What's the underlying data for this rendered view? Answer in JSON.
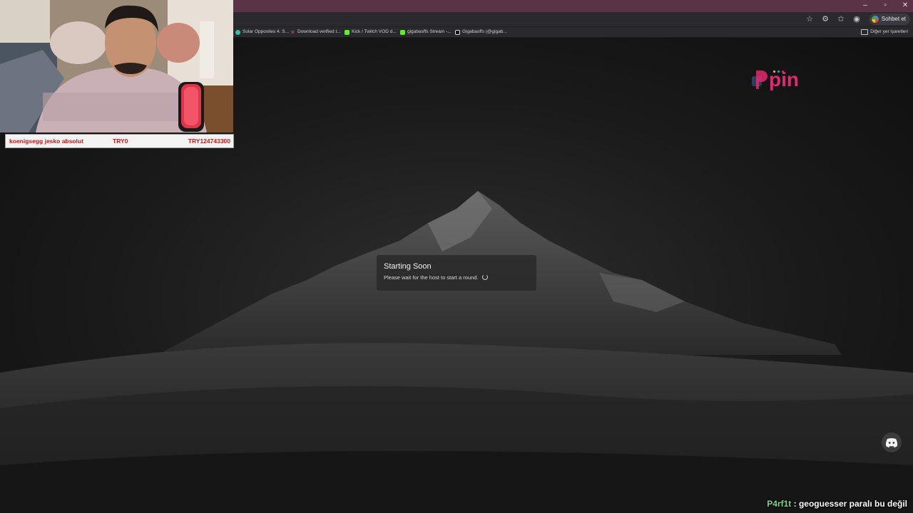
{
  "browser": {
    "window_controls": [
      "–",
      "▫",
      "✕"
    ],
    "chat_button_label": "Sohbet et",
    "bookmarks": [
      {
        "label": "Solar Opposites 4. S...",
        "icon": "green-circle",
        "color": "#38c09a"
      },
      {
        "label": "Download verified t...",
        "icon": "red-x",
        "color": "#e2533a"
      },
      {
        "label": "Kick / Twitch VOD d...",
        "icon": "green-square",
        "color": "#53fc18"
      },
      {
        "label": "gigabasffs Stream -...",
        "icon": "kick-k",
        "color": "#53fc18"
      },
      {
        "label": "Gigabasffs (@gigab...",
        "icon": "tiktok",
        "color": "#ffffff"
      }
    ],
    "other_bookmarks_label": "Diğer yer işaretleri"
  },
  "page": {
    "logo_text": "pin",
    "logo_color": "#e0296f",
    "modal": {
      "title": "Starting Soon",
      "message": "Please wait for the host to start a round."
    }
  },
  "overlay": {
    "donation": {
      "name": "koenigsegg jesko absolut",
      "amount_left": "TRY0",
      "amount_right": "TRY124743300"
    },
    "chat": {
      "user": "P4rf1t",
      "separator": " : ",
      "message": "geoguesser paralı bu değil"
    }
  }
}
